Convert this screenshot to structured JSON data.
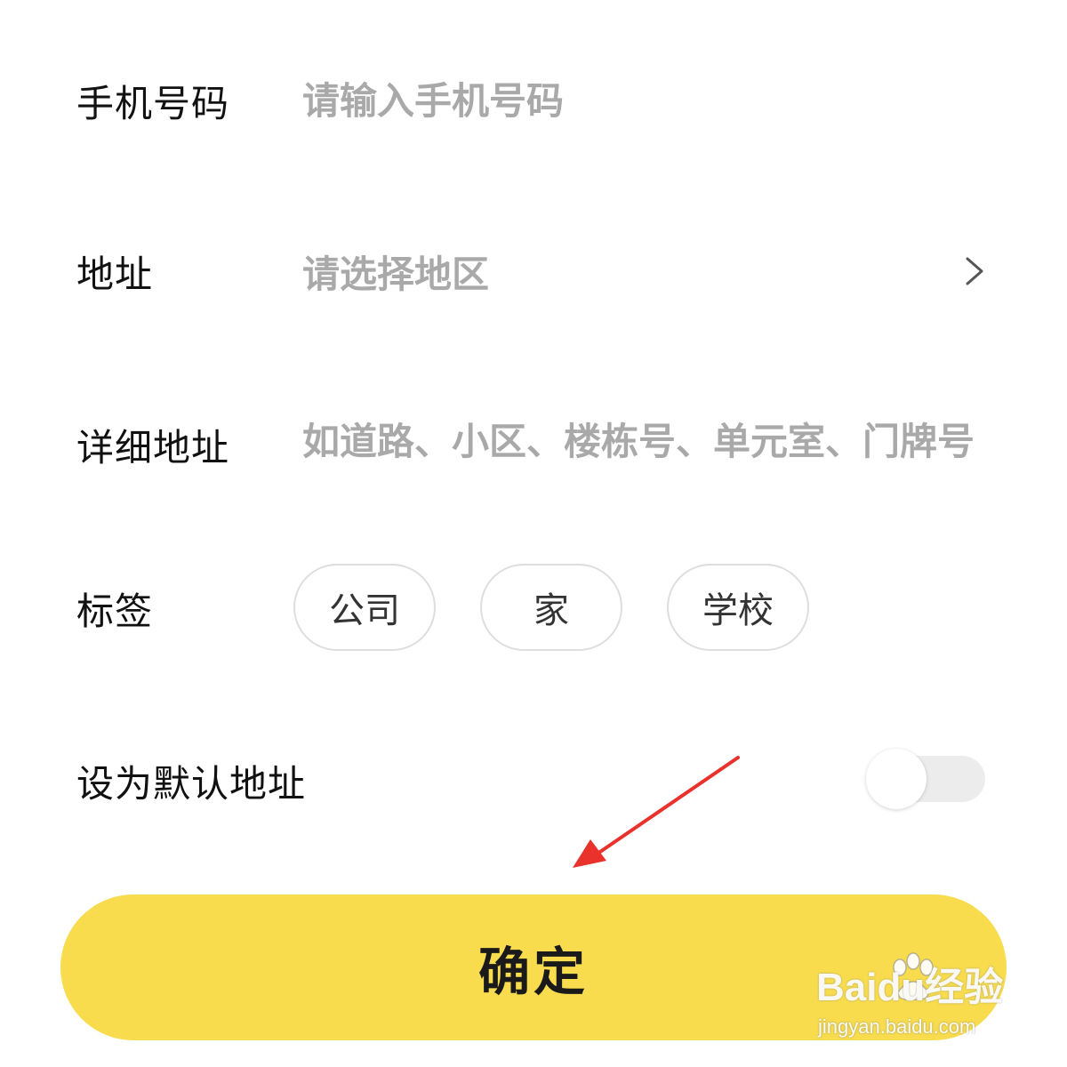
{
  "form": {
    "phone": {
      "label": "手机号码",
      "placeholder": "请输入手机号码",
      "value": ""
    },
    "address": {
      "label": "地址",
      "placeholder": "请选择地区"
    },
    "detail_address": {
      "label": "详细地址",
      "placeholder": "如道路、小区、楼栋号、单元室、门牌号",
      "value": ""
    },
    "tags": {
      "label": "标签",
      "options": [
        "公司",
        "家",
        "学校"
      ]
    },
    "default_address": {
      "label": "设为默认地址",
      "enabled": false
    }
  },
  "actions": {
    "confirm_label": "确定"
  },
  "icons": {
    "region_chevron": "chevron-right-icon",
    "paw": "baidu-paw-icon"
  },
  "watermark": {
    "brand": "Baidu经验",
    "url": "jingyan.baidu.com"
  },
  "colors": {
    "accent": "#f8dc4e",
    "annotation_arrow": "#e8322b",
    "placeholder": "#a9a9a9",
    "label": "#111111"
  }
}
